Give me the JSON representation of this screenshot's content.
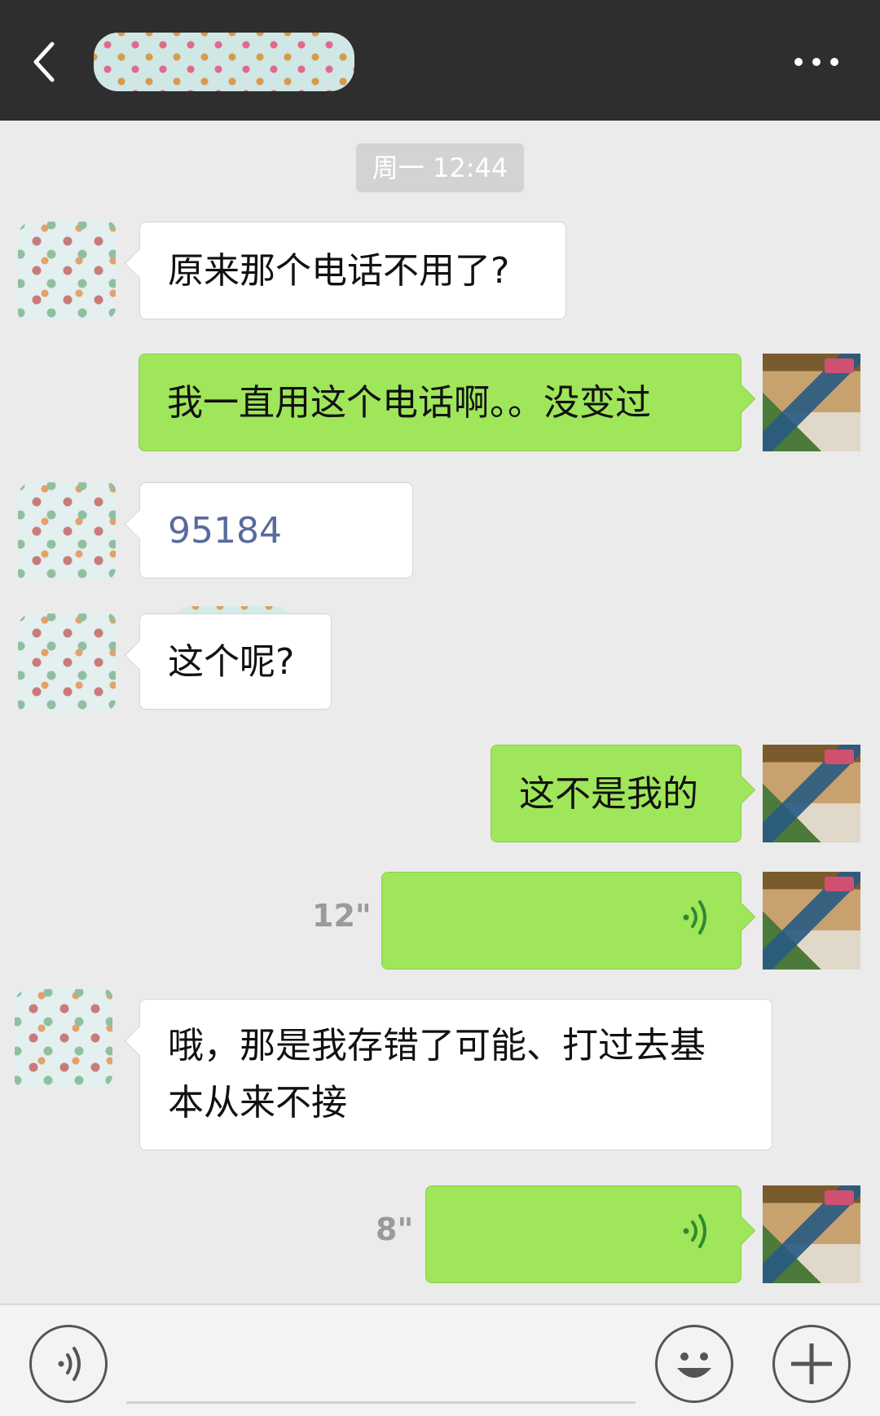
{
  "header": {
    "back_label": "back",
    "more_label": "more"
  },
  "timestamp": "周一 12:44",
  "messages": [
    {
      "side": "in",
      "text": "原来那个电话不用了?"
    },
    {
      "side": "out",
      "text": "我一直用这个电话啊。。没变过"
    },
    {
      "side": "in",
      "text": "95184"
    },
    {
      "side": "in",
      "text": "这个呢?"
    },
    {
      "side": "out",
      "text": "这不是我的"
    },
    {
      "side": "out",
      "type": "voice",
      "duration": "12\""
    },
    {
      "side": "in",
      "text_line1": "哦，那是我存错了可能、打过去基",
      "text_line2": "本从来不接"
    },
    {
      "side": "out",
      "type": "voice",
      "duration": "8\""
    }
  ],
  "colors": {
    "header_bg": "#2e2e2e",
    "chat_bg": "#ebebeb",
    "bubble_out": "#9fe65a",
    "bubble_in": "#ffffff",
    "link": "#586a9f"
  },
  "icons": [
    "back-arrow-icon",
    "more-dots-icon",
    "voice-wave-icon",
    "voice-input-icon",
    "emoji-icon",
    "plus-icon"
  ]
}
